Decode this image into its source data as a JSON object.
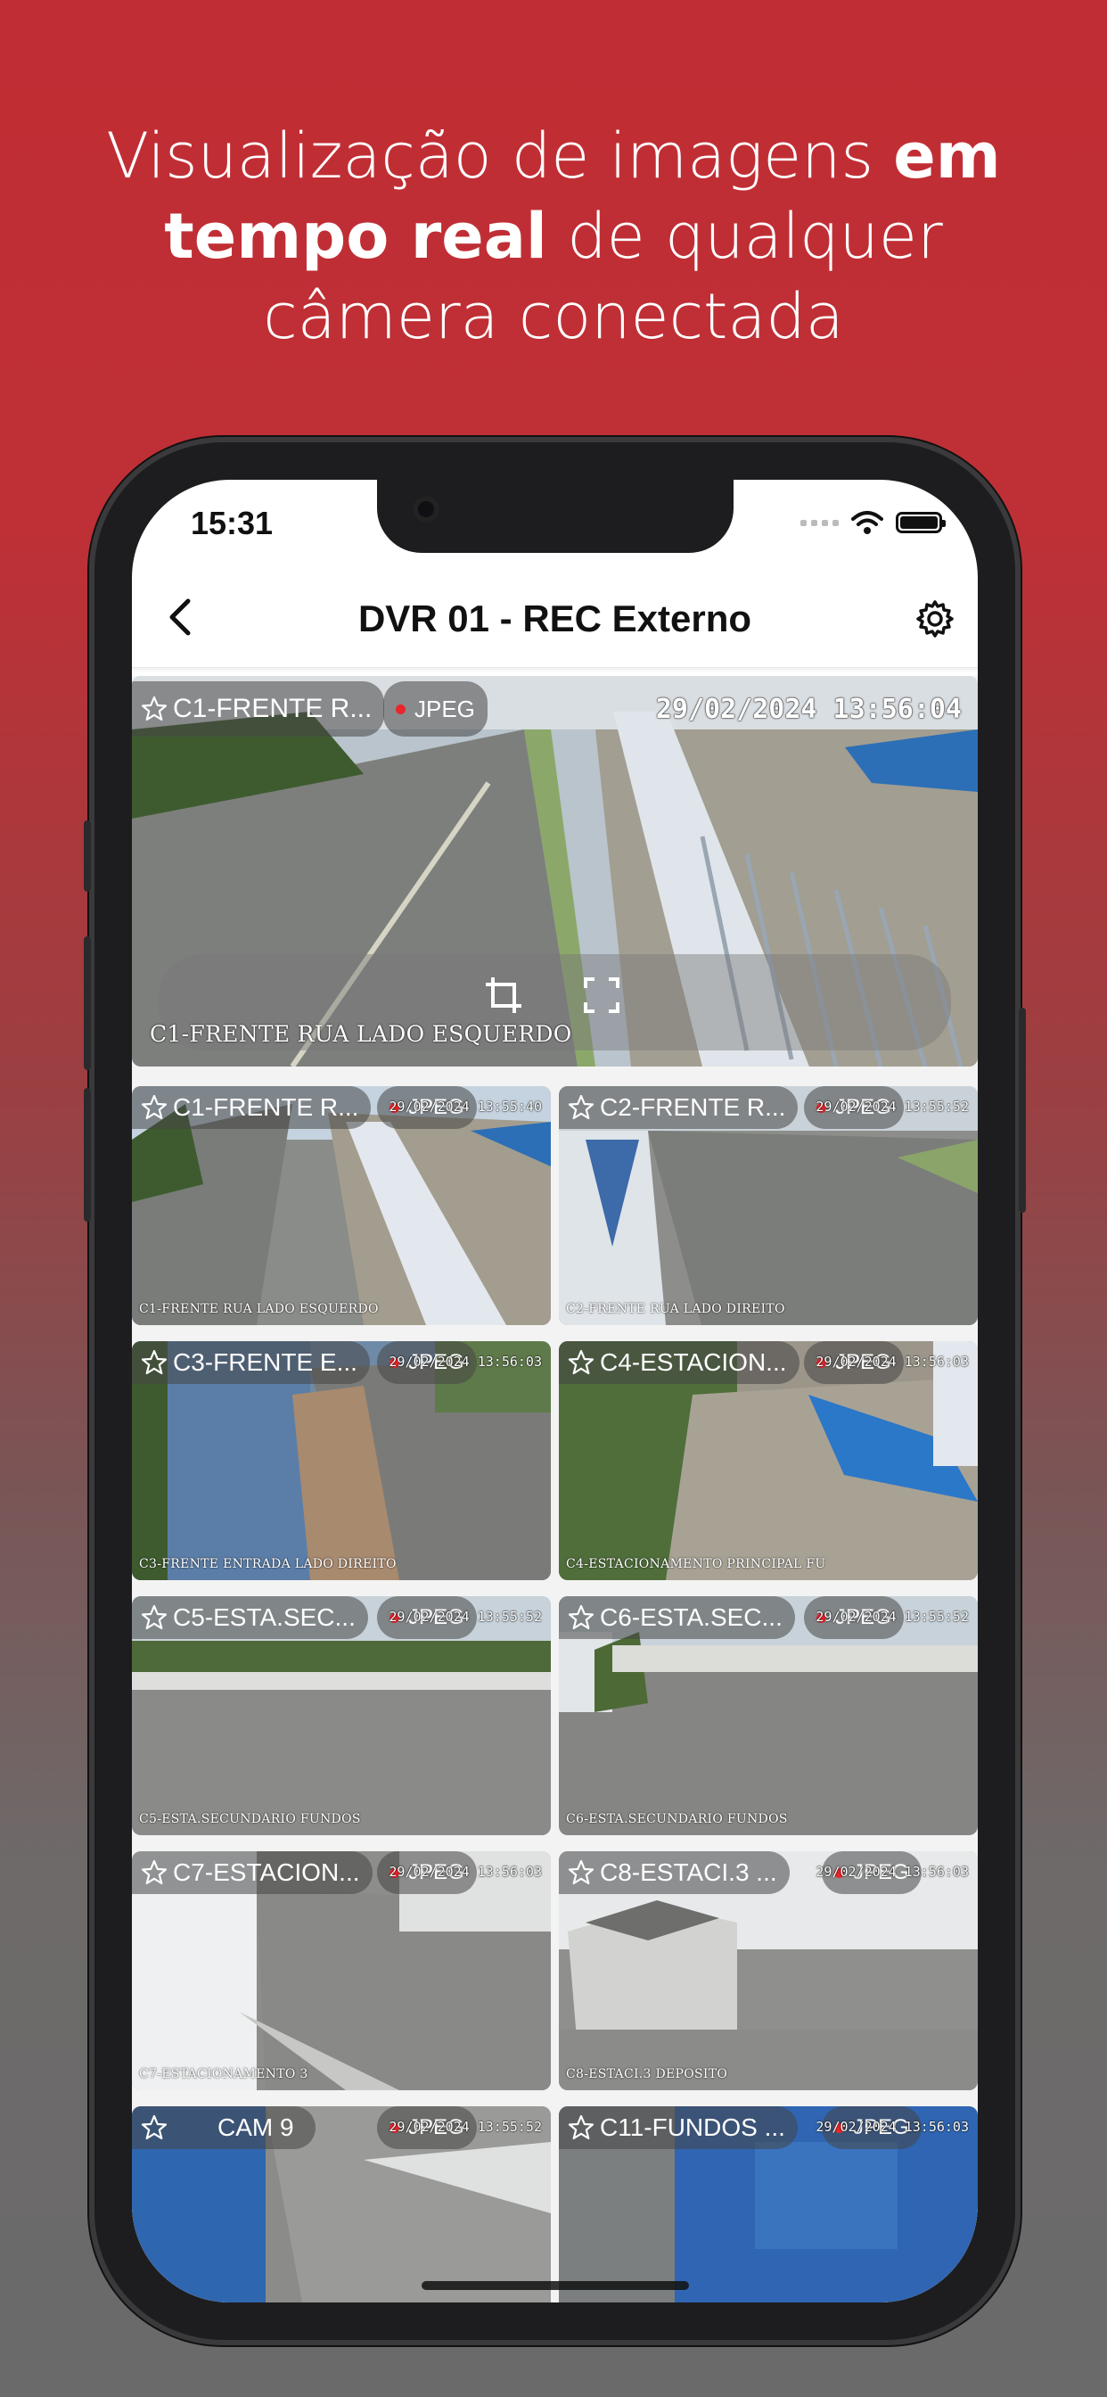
{
  "headline": {
    "line1_regular": "Visualização de imagens ",
    "line1_bold": "em",
    "line2_bold": "tempo real",
    "line2_regular": " de qualquer",
    "line3": "câmera conectada"
  },
  "status_bar": {
    "time": "15:31"
  },
  "nav": {
    "title": "DVR 01 - REC Externo"
  },
  "featured": {
    "name": "C1-FRENTE R...",
    "codec": "JPEG",
    "timestamp": "29/02/2024 13:56:04",
    "caption": "C1-FRENTE RUA LADO ESQUERDO"
  },
  "grid": [
    {
      "name": "C1-FRENTE R...",
      "codec": "JPEG",
      "timestamp": "29/02/2024 13:55:40",
      "caption": "C1-FRENTE RUA LADO ESQUERDO"
    },
    {
      "name": "C2-FRENTE R...",
      "codec": "JPEG",
      "timestamp": "29/02/2024 13:55:52",
      "caption": "C2-FRENTE RUA LADO DIREITO"
    },
    {
      "name": "C3-FRENTE E...",
      "codec": "JPEG",
      "timestamp": "29/02/2024 13:56:03",
      "caption": "C3-FRENTE ENTRADA LADO DIREITO"
    },
    {
      "name": "C4-ESTACION...",
      "codec": "JPEG",
      "timestamp": "29/02/2024 13:56:03",
      "caption": "C4-ESTACIONAMENTO PRINCIPAL FU"
    },
    {
      "name": "C5-ESTA.SEC...",
      "codec": "JPEG",
      "timestamp": "29/02/2024 13:55:52",
      "caption": "C5-ESTA.SECUNDARIO FUNDOS"
    },
    {
      "name": "C6-ESTA.SEC...",
      "codec": "JPEG",
      "timestamp": "29/02/2024 13:55:52",
      "caption": "C6-ESTA.SECUNDARIO FUNDOS"
    },
    {
      "name": "C7-ESTACION...",
      "codec": "JPEG",
      "timestamp": "29/02/2024 13:56:03",
      "caption": "C7-ESTACIONAMENTO 3"
    },
    {
      "name": "C8-ESTACI.3 ...",
      "codec": "JPEG",
      "timestamp": "29/02/2024 13:56:03",
      "caption": "C8-ESTACI.3 DEPOSITO"
    },
    {
      "name": "CAM 9",
      "codec": "JPEG",
      "timestamp": "29/02/2024 13:55:52",
      "caption": ""
    },
    {
      "name": "C11-FUNDOS ...",
      "codec": "JPEG",
      "timestamp": "29/02/2024 13:56:03",
      "caption": ""
    }
  ],
  "icons": {
    "back": "chevron-left-icon",
    "settings": "gear-icon",
    "favorite": "star-outline-icon",
    "crop": "crop-icon",
    "fullscreen": "fullscreen-icon",
    "wifi": "wifi-icon",
    "battery": "battery-icon"
  },
  "colors": {
    "brand_red": "#c12d34",
    "rec_dot": "#e8262b"
  }
}
